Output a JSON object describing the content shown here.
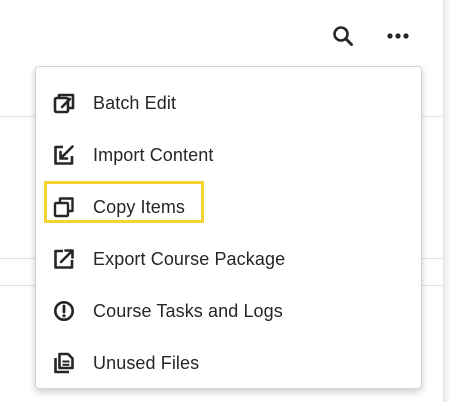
{
  "header": {
    "search_icon": "search-icon",
    "more_icon": "more-options-icon"
  },
  "menu": {
    "items": [
      {
        "label": "Batch Edit",
        "icon": "batch-edit-icon"
      },
      {
        "label": "Import Content",
        "icon": "import-content-icon"
      },
      {
        "label": "Copy Items",
        "icon": "copy-items-icon",
        "highlighted": true
      },
      {
        "label": "Export Course Package",
        "icon": "export-icon"
      },
      {
        "label": "Course Tasks and Logs",
        "icon": "alert-circle-icon"
      },
      {
        "label": "Unused Files",
        "icon": "unused-files-icon"
      }
    ]
  },
  "colors": {
    "highlight": "#f5d232",
    "text": "#262626",
    "menu_border": "#d3d3d3"
  }
}
